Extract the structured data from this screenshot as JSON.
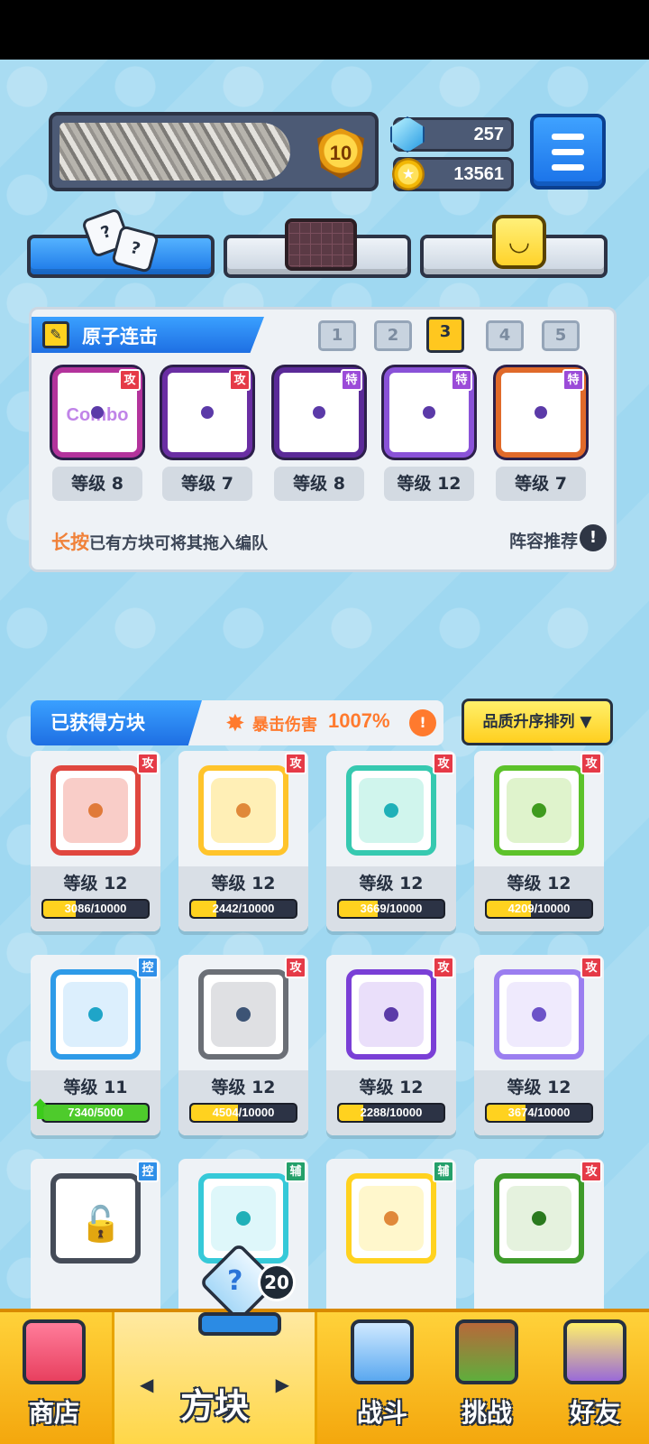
{
  "header": {
    "rank_level": "10",
    "gems": "257",
    "coins": "13561"
  },
  "tabs": [
    {
      "name": "dice",
      "active": true
    },
    {
      "name": "board",
      "active": false
    },
    {
      "name": "emote",
      "active": false
    }
  ],
  "deck": {
    "title": "原子连击",
    "deck_numbers": [
      "1",
      "2",
      "3",
      "4",
      "5"
    ],
    "active_deck": "3",
    "slots": [
      {
        "type_tag": "攻",
        "level": "等级 8",
        "watermark": "Combo",
        "border": "#b3339c"
      },
      {
        "type_tag": "攻",
        "level": "等级 7",
        "watermark": "",
        "border": "#6a2ea3"
      },
      {
        "type_tag": "特",
        "level": "等级 8",
        "watermark": "",
        "border": "#5b2a98"
      },
      {
        "type_tag": "特",
        "level": "等级 12",
        "watermark": "",
        "border": "#8a52d8"
      },
      {
        "type_tag": "特",
        "level": "等级 7",
        "watermark": "",
        "border": "#e06a2a"
      }
    ],
    "hint_highlight": "长按",
    "hint_rest": "已有方块可将其拖入编队",
    "lineup_label": "阵容推荐",
    "info_glyph": "!"
  },
  "collection": {
    "title": "已获得方块",
    "crit_label": "暴击伤害",
    "crit_value": "1007%",
    "crit_info_glyph": "!",
    "sort_label": "品质升序排列 ▼",
    "cards": [
      {
        "tag": "攻",
        "level": "等级 12",
        "progress": "3086/10000",
        "fraction": 0.31,
        "color": "#e0473f",
        "fill": "#f4a49b",
        "dot": "#e07a3a"
      },
      {
        "tag": "攻",
        "level": "等级 12",
        "progress": "2442/10000",
        "fraction": 0.24,
        "color": "#ffc42b",
        "fill": "#ffe27a",
        "dot": "#e0893a"
      },
      {
        "tag": "攻",
        "level": "等级 12",
        "progress": "3669/10000",
        "fraction": 0.37,
        "color": "#36c9b0",
        "fill": "#a9ecdf",
        "dot": "#1fb0b8"
      },
      {
        "tag": "攻",
        "level": "等级 12",
        "progress": "4209/10000",
        "fraction": 0.42,
        "color": "#5cc22a",
        "fill": "#c5eaa2",
        "dot": "#3f9b1e"
      },
      {
        "tag": "控",
        "level": "等级 11",
        "progress": "7340/5000",
        "fraction": 1,
        "full": true,
        "color": "#2e9be8",
        "fill": "#bfe2fb",
        "dot": "#1fa5c8"
      },
      {
        "tag": "攻",
        "level": "等级 12",
        "progress": "4504/10000",
        "fraction": 0.45,
        "color": "#6b6f76",
        "fill": "#c4c7cc",
        "dot": "#3d5475"
      },
      {
        "tag": "攻",
        "level": "等级 12",
        "progress": "2288/10000",
        "fraction": 0.23,
        "color": "#7a3fd6",
        "fill": "#d8c4f6",
        "dot": "#5b3aa8"
      },
      {
        "tag": "攻",
        "level": "等级 12",
        "progress": "3674/10000",
        "fraction": 0.37,
        "color": "#9b7ef0",
        "fill": "#e1d8fb",
        "dot": "#6c52c8"
      },
      {
        "tag": "控",
        "level": "",
        "progress": "",
        "fraction": 0,
        "locked": true,
        "color": "#454c58",
        "fill": "#ffffff",
        "dot": "#ffffff"
      },
      {
        "tag": "辅",
        "level": "",
        "progress": "",
        "fraction": 0,
        "color": "#36c9d8",
        "fill": "#c2f1f5",
        "dot": "#1fb0b8"
      },
      {
        "tag": "辅",
        "level": "",
        "progress": "",
        "fraction": 0,
        "color": "#ffd21f",
        "fill": "#fff0a3",
        "dot": "#e0893a"
      },
      {
        "tag": "攻",
        "level": "",
        "progress": "",
        "fraction": 0,
        "color": "#3e9b2a",
        "fill": "#cfe8c3",
        "dot": "#2a7a1e"
      }
    ]
  },
  "bottom_nav": {
    "shop": "商店",
    "blocks": "方块",
    "blocks_badge": "20",
    "battle": "战斗",
    "challenge": "挑战",
    "friends": "好友",
    "arrow_left": "◀",
    "arrow_right": "▶"
  },
  "icons": {
    "dice_glyph": "?",
    "face_glyph": "◡",
    "pencil_glyph": "✎",
    "crit_glyph": "✸",
    "up_arrow_glyph": "⬆",
    "lock_glyph": "🔓",
    "coin_glyph": "★",
    "cube_glyph": "?"
  },
  "tag_colors": {
    "攻": "#e53a47",
    "特": "#9b4bd8",
    "控": "#2f8fe8",
    "辅": "#24a06a"
  }
}
